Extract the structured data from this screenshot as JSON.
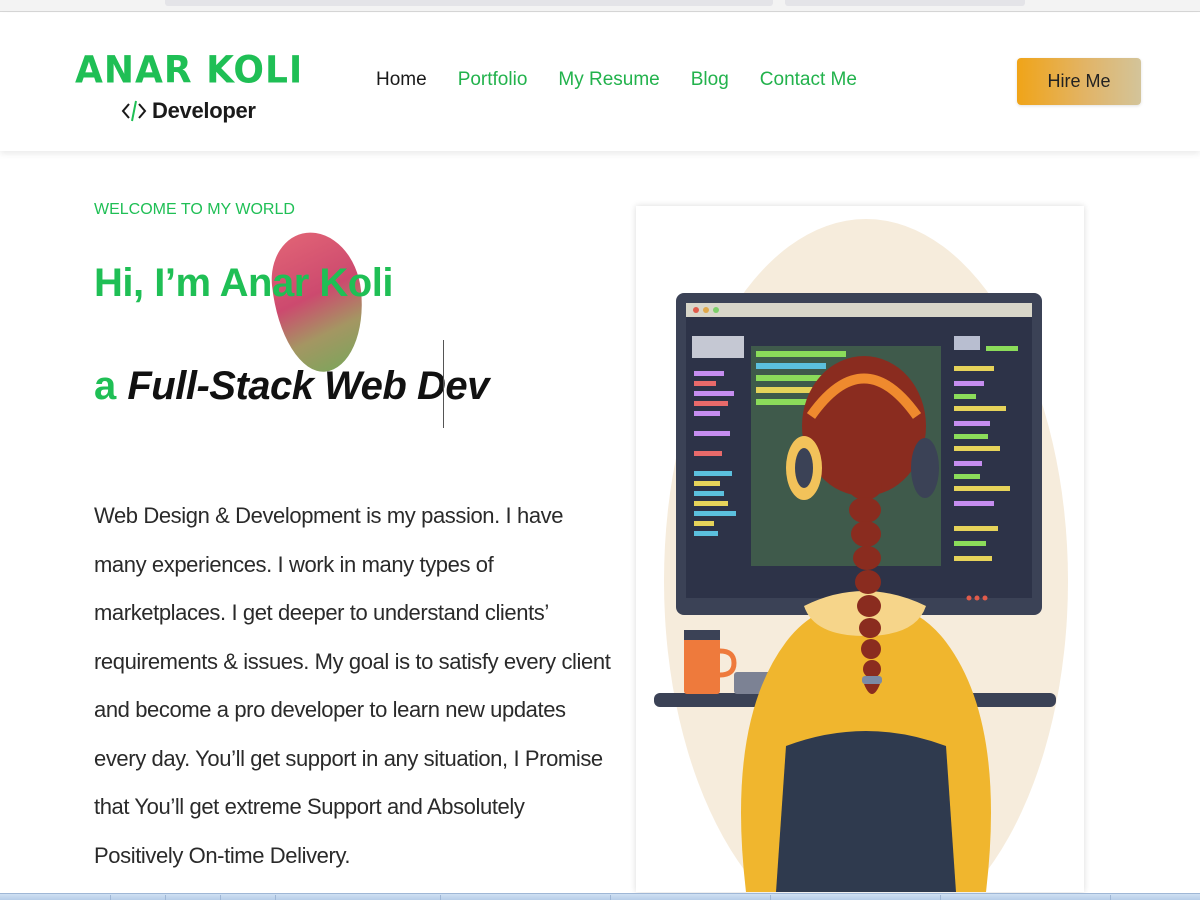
{
  "logo": {
    "title": "ANAR KOLI",
    "subtitle": "Developer",
    "icon": "code-brackets-icon"
  },
  "nav": {
    "items": [
      {
        "label": "Home",
        "active": true
      },
      {
        "label": "Portfolio",
        "active": false
      },
      {
        "label": "My Resume",
        "active": false
      },
      {
        "label": "Blog",
        "active": false
      },
      {
        "label": "Contact Me",
        "active": false
      }
    ]
  },
  "header": {
    "hire_label": "Hire Me"
  },
  "hero": {
    "welcome": "WELCOME TO MY WORLD",
    "title": "Hi, I’m Anar Koli",
    "role_prefix": "a",
    "role_text": "Full-Stack Web Dev",
    "bio": "Web Design & Development is my passion. I have many experiences. I work in many types of marketplaces. I get deeper to understand clients’ requirements & issues. My goal is to satisfy every client and become a pro developer to learn new updates every day. You’ll get support in any situation, I Promise that You’ll get extreme Support and Absolutely Positively On-time Delivery."
  },
  "colors": {
    "accent": "#1fbf55",
    "text": "#2a2a2a",
    "button_start": "#f0a418",
    "button_end": "#d3c49a"
  },
  "illustration": {
    "icon": "developer-at-computer-illustration"
  }
}
